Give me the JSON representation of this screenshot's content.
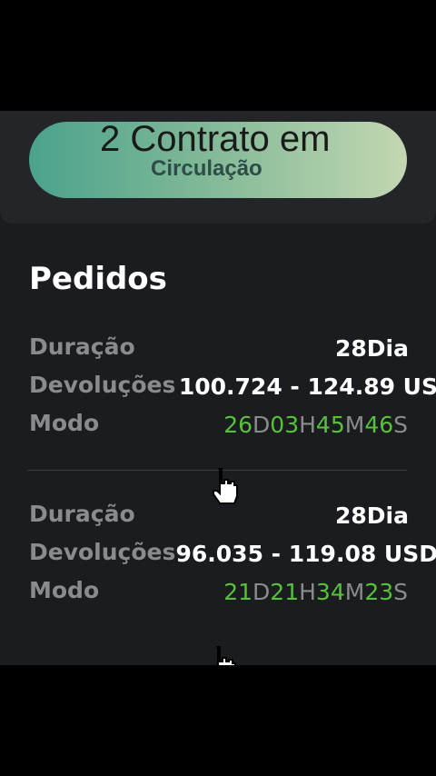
{
  "banner": {
    "title": "2 Contrato em",
    "subtitle": "Circulação"
  },
  "section": {
    "title": "Pedidos"
  },
  "orders": [
    {
      "duration_label": "Duração",
      "duration_value": "28Dia",
      "returns_label": "Devoluções",
      "returns_value": "100.724 - 124.89 US",
      "mode_label": "Modo",
      "timer": {
        "d": "26",
        "d_unit": "D",
        "h": "03",
        "h_unit": "H",
        "m": "45",
        "m_unit": "M",
        "s": "46",
        "s_unit": "S"
      }
    },
    {
      "duration_label": "Duração",
      "duration_value": "28Dia",
      "returns_label": "Devoluções",
      "returns_value": "96.035 - 119.08 USD",
      "mode_label": "Modo",
      "timer": {
        "d": "21",
        "d_unit": "D",
        "h": "21",
        "h_unit": "H",
        "m": "34",
        "m_unit": "M",
        "s": "23",
        "s_unit": "S"
      }
    }
  ],
  "colors": {
    "timer_number": "#56c23a",
    "timer_unit": "#8a8b8d",
    "label": "#8a8b8d",
    "pill_gradient_start": "#4aa28c",
    "pill_gradient_end": "#c3d7b1"
  },
  "icons": {
    "cursor": "hand-pointer-icon"
  }
}
